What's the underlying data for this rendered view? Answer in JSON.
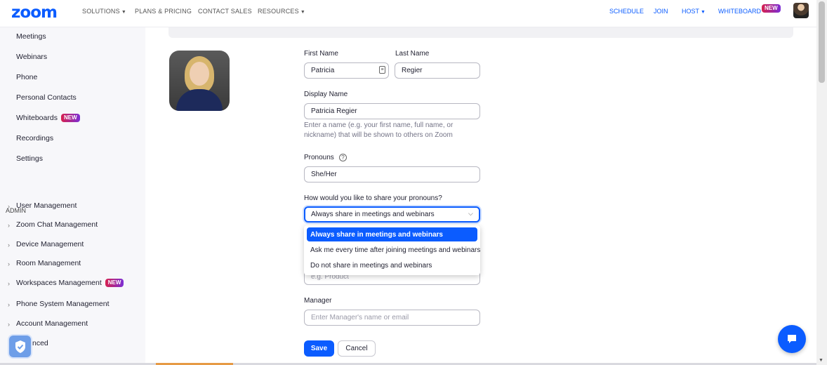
{
  "nav": {
    "logo": "zoom",
    "left": [
      "SOLUTIONS",
      "PLANS & PRICING",
      "CONTACT SALES",
      "RESOURCES"
    ],
    "right": [
      "SCHEDULE",
      "JOIN",
      "HOST",
      "WHITEBOARD"
    ],
    "badge": "NEW"
  },
  "sidebar": {
    "items": [
      "Meetings",
      "Webinars",
      "Phone",
      "Personal Contacts",
      "Whiteboards",
      "Recordings",
      "Settings"
    ],
    "admin_label": "ADMIN",
    "admin_items": [
      "User Management",
      "Zoom Chat Management",
      "Device Management",
      "Room Management",
      "Workspaces Management",
      "Phone System Management",
      "Account Management",
      "nced"
    ],
    "badge": "NEW"
  },
  "form": {
    "first_name_label": "First Name",
    "first_name_value": "Patricia",
    "last_name_label": "Last Name",
    "last_name_value": "Regier",
    "display_name_label": "Display Name",
    "display_name_value": "Patricia Regier",
    "display_name_hint": "Enter a name (e.g. your first name, full name, or nickname) that will be shown to others on Zoom",
    "pronouns_label": "Pronouns",
    "pronouns_value": "She/Her",
    "share_label": "How would you like to share your pronouns?",
    "share_value": "Always share in meetings and webinars",
    "share_options": [
      "Always share in meetings and webinars",
      "Ask me every time after joining meetings and webinars",
      "Do not share in meetings and webinars"
    ],
    "department_placeholder": "e.g. Product",
    "manager_label": "Manager",
    "manager_placeholder": "Enter Manager's name or email",
    "save_label": "Save",
    "cancel_label": "Cancel"
  },
  "colors": {
    "brand": "#0b5cff",
    "new_badge": "#d6214f"
  }
}
